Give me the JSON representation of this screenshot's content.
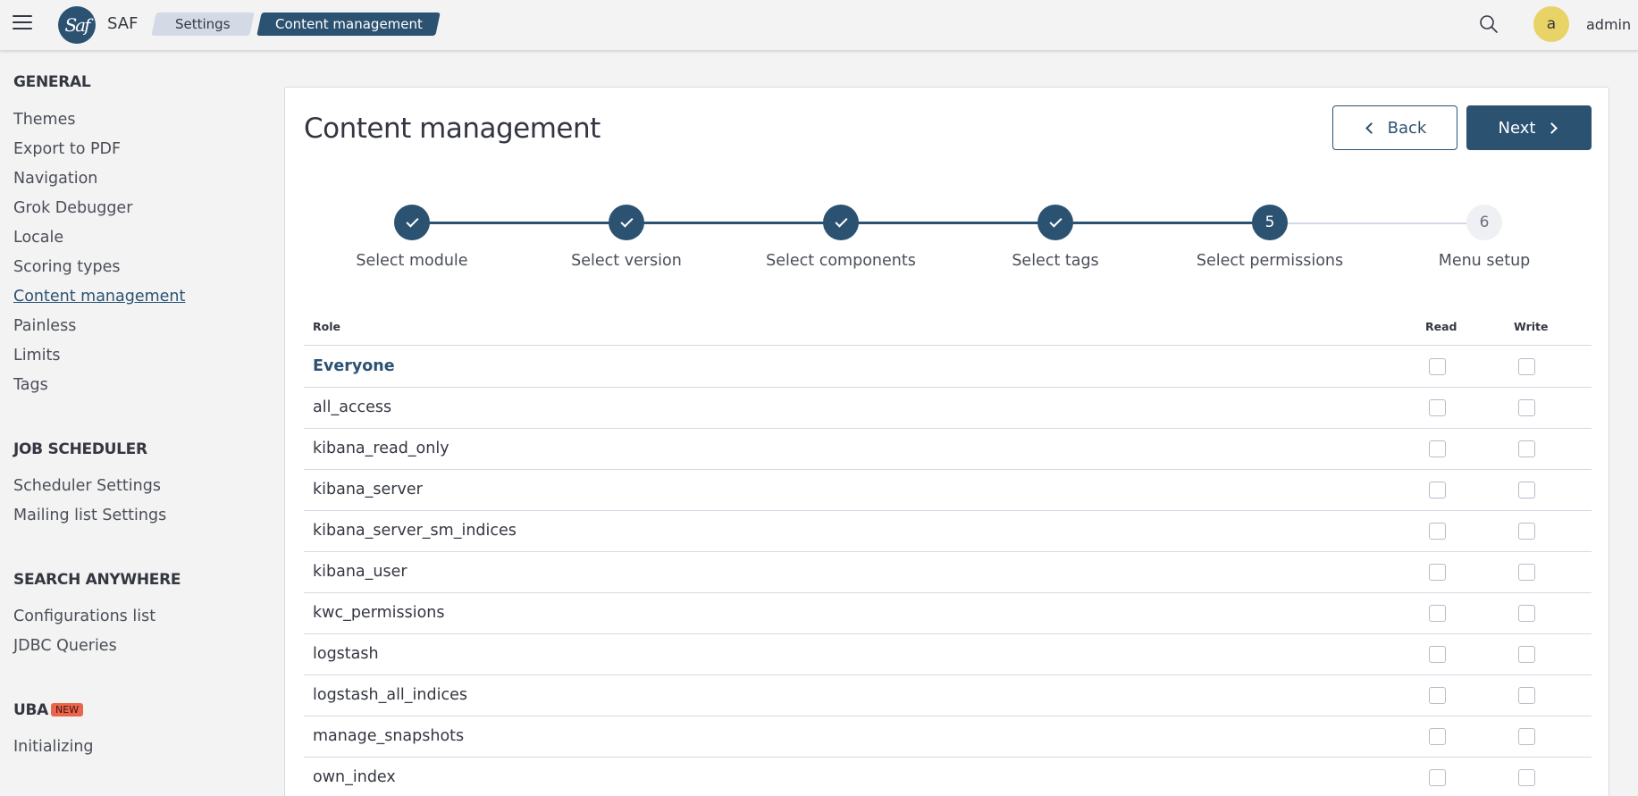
{
  "header": {
    "app_name": "SAF",
    "logo_text": "Saf",
    "breadcrumbs": [
      "Settings",
      "Content management"
    ],
    "avatar_letter": "a",
    "username": "admin",
    "icons": {
      "menu": "hamburger-icon",
      "search": "search-icon"
    }
  },
  "sidebar": {
    "sections": [
      {
        "title": "GENERAL",
        "items": [
          "Themes",
          "Export to PDF",
          "Navigation",
          "Grok Debugger",
          "Locale",
          "Scoring types",
          "Content management",
          "Painless",
          "Limits",
          "Tags"
        ]
      },
      {
        "title": "JOB SCHEDULER",
        "items": [
          "Scheduler Settings",
          "Mailing list Settings"
        ]
      },
      {
        "title": "SEARCH ANYWHERE",
        "items": [
          "Configurations list",
          "JDBC Queries"
        ]
      },
      {
        "title": "UBA",
        "badge": "NEW",
        "items": [
          "Initializing"
        ]
      }
    ],
    "active_item": "Content management"
  },
  "main": {
    "title": "Content management",
    "back_label": "Back",
    "next_label": "Next",
    "steps": [
      {
        "label": "Select module",
        "status": "done"
      },
      {
        "label": "Select version",
        "status": "done"
      },
      {
        "label": "Select components",
        "status": "done"
      },
      {
        "label": "Select tags",
        "status": "done"
      },
      {
        "label": "Select permissions",
        "number": "5",
        "status": "current"
      },
      {
        "label": "Menu setup",
        "number": "6",
        "status": "todo"
      }
    ],
    "table": {
      "columns": [
        "Role",
        "Read",
        "Write"
      ],
      "rows": [
        {
          "role": "Everyone",
          "read": false,
          "write": false
        },
        {
          "role": "all_access",
          "read": false,
          "write": false
        },
        {
          "role": "kibana_read_only",
          "read": false,
          "write": false
        },
        {
          "role": "kibana_server",
          "read": false,
          "write": false
        },
        {
          "role": "kibana_server_sm_indices",
          "read": false,
          "write": false
        },
        {
          "role": "kibana_user",
          "read": false,
          "write": false
        },
        {
          "role": "kwc_permissions",
          "read": false,
          "write": false
        },
        {
          "role": "logstash",
          "read": false,
          "write": false
        },
        {
          "role": "logstash_all_indices",
          "read": false,
          "write": false
        },
        {
          "role": "manage_snapshots",
          "read": false,
          "write": false
        },
        {
          "role": "own_index",
          "read": false,
          "write": false
        }
      ]
    }
  },
  "colors": {
    "primary": "#2c5272",
    "avatar": "#e8d366",
    "badge": "#e7664c",
    "background": "#f3f3f3"
  }
}
